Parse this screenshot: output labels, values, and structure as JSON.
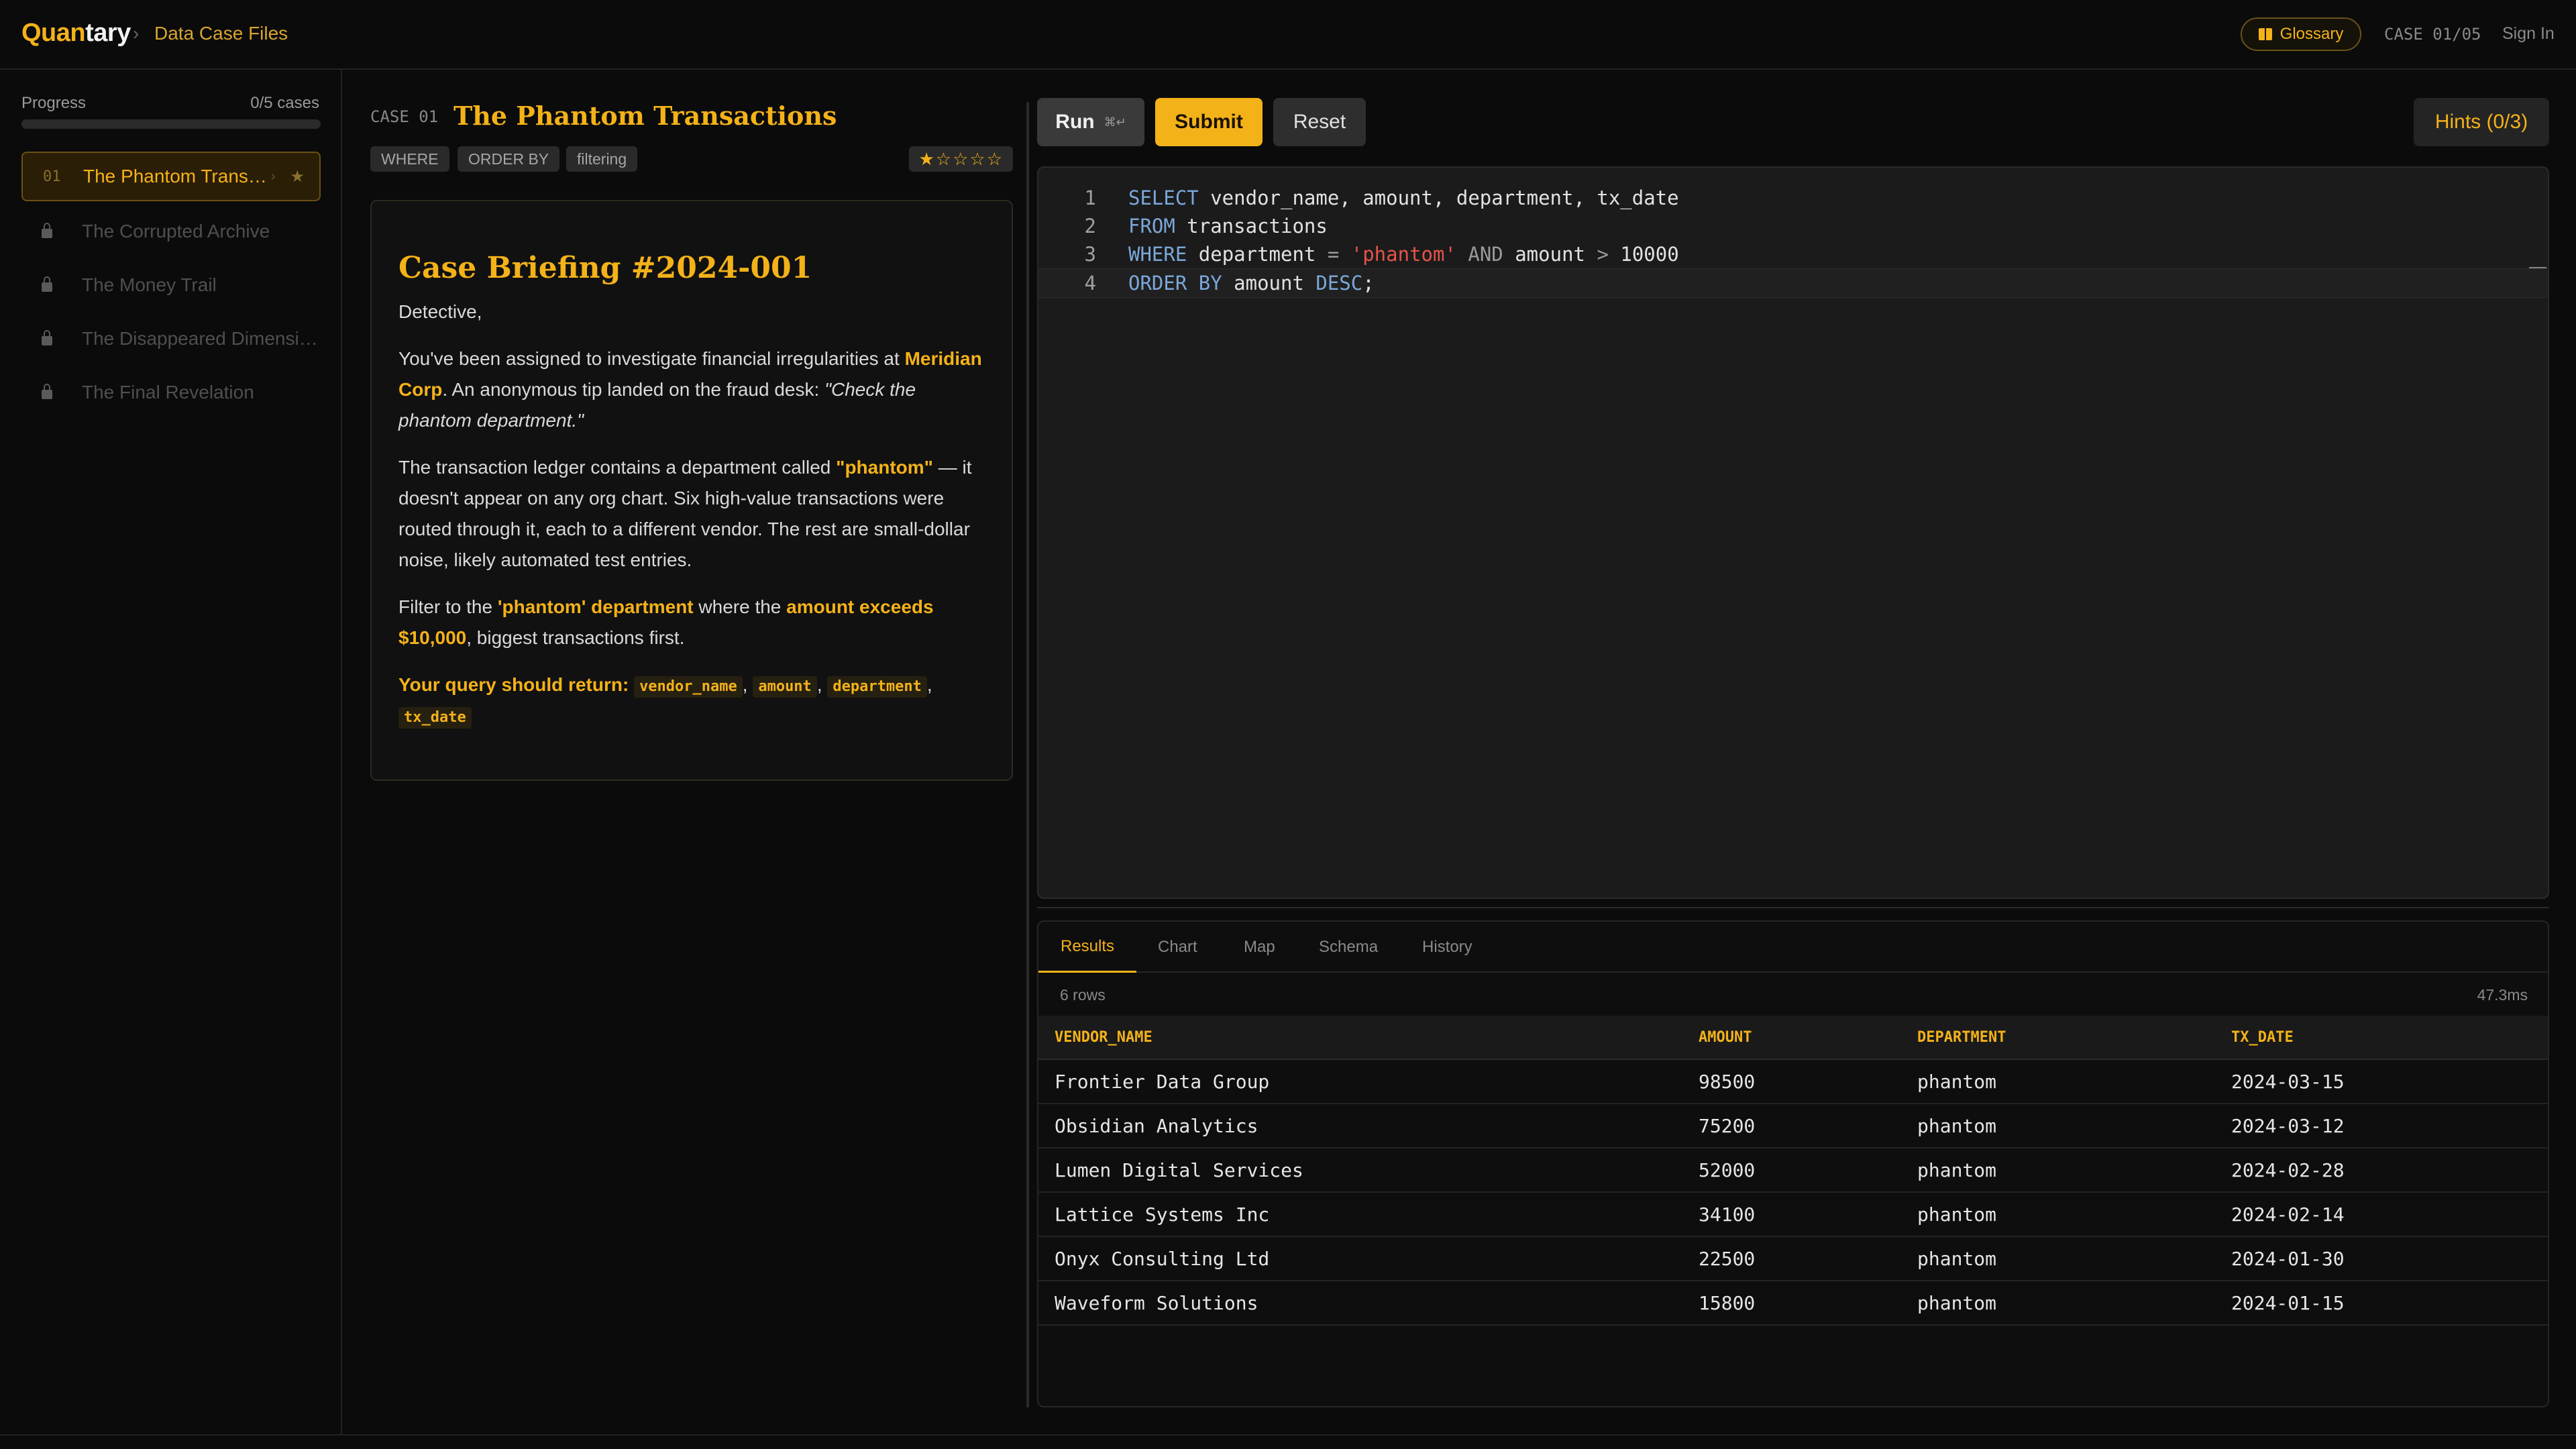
{
  "header": {
    "brand_part1": "Quan",
    "brand_part2": "tary",
    "crumb_sep": "›",
    "crumb": "Data Case Files",
    "glossary_label": "Glossary",
    "case_counter": "CASE 01/05",
    "sign_in": "Sign In"
  },
  "sidebar": {
    "progress_label": "Progress",
    "progress_count": "0/5 cases",
    "progress_fraction": 0,
    "cases": [
      {
        "num": "01",
        "title": "The Phantom Transactions",
        "active": true,
        "locked": false
      },
      {
        "num": "",
        "title": "The Corrupted Archive",
        "active": false,
        "locked": true
      },
      {
        "num": "",
        "title": "The Money Trail",
        "active": false,
        "locked": true
      },
      {
        "num": "",
        "title": "The Disappeared Dimensions",
        "active": false,
        "locked": true
      },
      {
        "num": "",
        "title": "The Final Revelation",
        "active": false,
        "locked": true
      }
    ],
    "active_chevron": "›",
    "active_star": "★"
  },
  "case": {
    "label": "CASE 01",
    "title": "The Phantom Transactions",
    "tags": [
      "WHERE",
      "ORDER BY",
      "filtering"
    ],
    "difficulty": "★☆☆☆☆",
    "briefing": {
      "heading": "Case Briefing #2024-001",
      "greeting": "Detective,",
      "p1_a": "You've been assigned to investigate financial irregularities at ",
      "p1_company": "Meridian Corp",
      "p1_b": ". An anonymous tip landed on the fraud desk: ",
      "p1_quote": "\"Check the phantom department.\"",
      "p2_a": "The transaction ledger contains a department called ",
      "p2_dept": "\"phantom\"",
      "p2_b": " — it doesn't appear on any org chart. Six high-value transactions were routed through it, each to a different vendor. The rest are small-dollar noise, likely automated test entries.",
      "p3_a": "Filter to the ",
      "p3_filter": "'phantom' department",
      "p3_b": " where the ",
      "p3_amount": "amount exceeds $10,000",
      "p3_c": ", biggest transactions first.",
      "return_label": "Your query should return:",
      "return_cols": [
        "vendor_name",
        "amount",
        "department",
        "tx_date"
      ],
      "comma": ","
    }
  },
  "toolbar": {
    "run": "Run",
    "run_shortcut": "⌘↵",
    "submit": "Submit",
    "reset": "Reset",
    "hints": "Hints (0/3)"
  },
  "editor": {
    "lines": [
      {
        "n": "1",
        "tokens": [
          {
            "t": "kw",
            "v": "SELECT"
          },
          {
            "t": "id",
            "v": " vendor_name, amount, department, tx_date"
          }
        ]
      },
      {
        "n": "2",
        "tokens": [
          {
            "t": "kw",
            "v": "FROM"
          },
          {
            "t": "id",
            "v": " transactions"
          }
        ]
      },
      {
        "n": "3",
        "tokens": [
          {
            "t": "kw",
            "v": "WHERE"
          },
          {
            "t": "id",
            "v": " department "
          },
          {
            "t": "op",
            "v": "="
          },
          {
            "t": "id",
            "v": " "
          },
          {
            "t": "str",
            "v": "'phantom'"
          },
          {
            "t": "id",
            "v": " "
          },
          {
            "t": "op",
            "v": "AND"
          },
          {
            "t": "id",
            "v": " amount "
          },
          {
            "t": "op",
            "v": ">"
          },
          {
            "t": "id",
            "v": " 10000"
          }
        ]
      },
      {
        "n": "4",
        "tokens": [
          {
            "t": "kw",
            "v": "ORDER BY"
          },
          {
            "t": "id",
            "v": " amount "
          },
          {
            "t": "kw",
            "v": "DESC"
          },
          {
            "t": "id",
            "v": ";"
          }
        ]
      }
    ]
  },
  "results": {
    "tabs": [
      "Results",
      "Chart",
      "Map",
      "Schema",
      "History"
    ],
    "active_tab": "Results",
    "row_count": "6 rows",
    "timing": "47.3ms",
    "columns": [
      "VENDOR_NAME",
      "AMOUNT",
      "DEPARTMENT",
      "TX_DATE"
    ],
    "rows": [
      [
        "Frontier Data Group",
        "98500",
        "phantom",
        "2024-03-15"
      ],
      [
        "Obsidian Analytics",
        "75200",
        "phantom",
        "2024-03-12"
      ],
      [
        "Lumen Digital Services",
        "52000",
        "phantom",
        "2024-02-28"
      ],
      [
        "Lattice Systems Inc",
        "34100",
        "phantom",
        "2024-02-14"
      ],
      [
        "Onyx Consulting Ltd",
        "22500",
        "phantom",
        "2024-01-30"
      ],
      [
        "Waveform Solutions",
        "15800",
        "phantom",
        "2024-01-15"
      ]
    ]
  }
}
